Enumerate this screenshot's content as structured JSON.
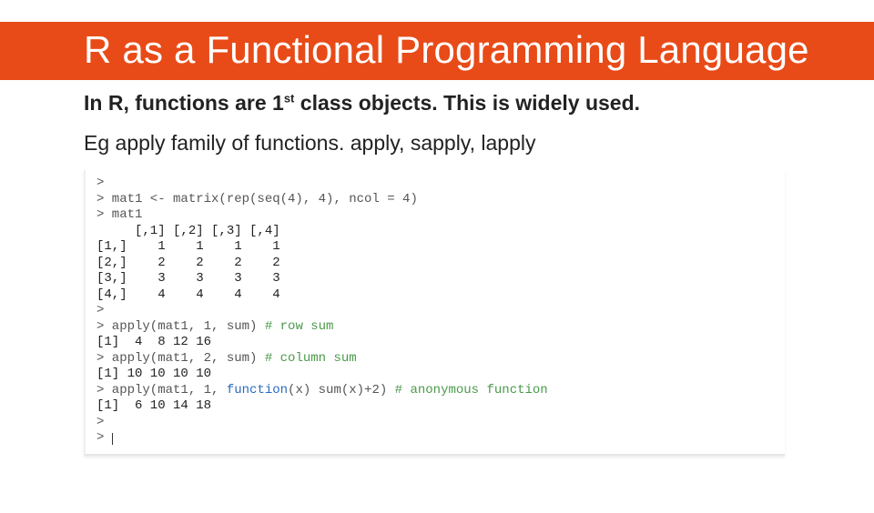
{
  "header": {
    "title": "R as a Functional Programming Language"
  },
  "content": {
    "subhead_pre": "In R, functions are 1",
    "subhead_sup": "st",
    "subhead_post": " class objects.  This is widely used.",
    "body_line": "Eg apply family of functions. apply, sapply, lapply"
  },
  "code": {
    "lines": [
      {
        "t": "prompt",
        "text": "> "
      },
      {
        "t": "prompt",
        "text": "> mat1 <- matrix(rep(seq(4), 4), ncol = 4)"
      },
      {
        "t": "prompt",
        "text": "> mat1"
      },
      {
        "t": "out",
        "text": "     [,1] [,2] [,3] [,4]"
      },
      {
        "t": "out",
        "text": "[1,]    1    1    1    1"
      },
      {
        "t": "out",
        "text": "[2,]    2    2    2    2"
      },
      {
        "t": "out",
        "text": "[3,]    3    3    3    3"
      },
      {
        "t": "out",
        "text": "[4,]    4    4    4    4"
      },
      {
        "t": "prompt",
        "text": "> "
      },
      {
        "t": "cmd",
        "prefix": "> apply(mat1, 1, sum) ",
        "comment": "# row sum"
      },
      {
        "t": "out",
        "text": "[1]  4  8 12 16"
      },
      {
        "t": "cmd",
        "prefix": "> apply(mat1, 2, sum) ",
        "comment": "# column sum"
      },
      {
        "t": "out",
        "text": "[1] 10 10 10 10"
      },
      {
        "t": "cmd2",
        "prefix": "> apply(mat1, 1, ",
        "fn": "function",
        "mid": "(x) sum(x)+2) ",
        "comment": "# anonymous function"
      },
      {
        "t": "out",
        "text": "[1]  6 10 14 18"
      },
      {
        "t": "prompt",
        "text": "> "
      },
      {
        "t": "caret",
        "text": "> "
      }
    ]
  }
}
